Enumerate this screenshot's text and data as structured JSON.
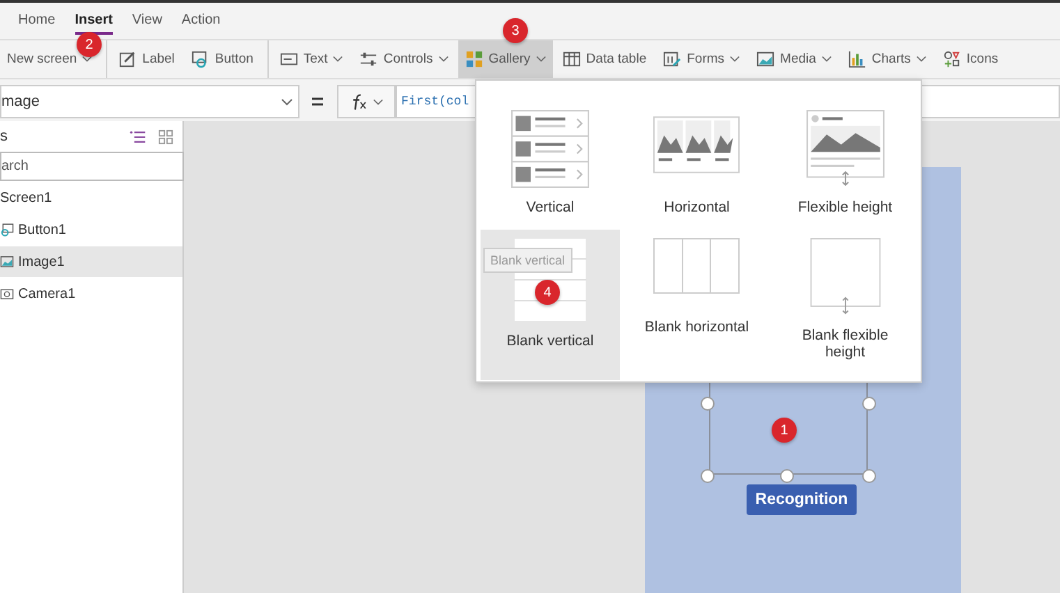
{
  "menu": [
    {
      "label": "Home",
      "selected": false
    },
    {
      "label": "Insert",
      "selected": true
    },
    {
      "label": "View",
      "selected": false
    },
    {
      "label": "Action",
      "selected": false
    }
  ],
  "toolbar": {
    "groups": [
      [
        {
          "label": "New screen",
          "dropdown": true,
          "selected": false
        }
      ],
      [
        {
          "label": "Label",
          "dropdown": false,
          "selected": false
        },
        {
          "label": "Button",
          "dropdown": false,
          "selected": false
        }
      ],
      [
        {
          "label": "Text",
          "dropdown": true,
          "selected": false
        },
        {
          "label": "Controls",
          "dropdown": true,
          "selected": false
        },
        {
          "label": "Gallery",
          "dropdown": true,
          "selected": true
        },
        {
          "label": "Data table",
          "dropdown": false,
          "selected": false
        },
        {
          "label": "Forms",
          "dropdown": true,
          "selected": false
        },
        {
          "label": "Media",
          "dropdown": true,
          "selected": false
        },
        {
          "label": "Charts",
          "dropdown": true,
          "selected": false
        },
        {
          "label": "Icons",
          "dropdown": false,
          "selected": false
        }
      ]
    ]
  },
  "formula_bar": {
    "property": "mage",
    "formula": "First(col"
  },
  "tree_view": {
    "title": "s",
    "search": {
      "placeholder": "arch"
    },
    "items": [
      {
        "label": "Screen1",
        "selected": false,
        "children": [
          {
            "label": "Button1",
            "selected": false
          },
          {
            "label": "Image1",
            "selected": true
          },
          {
            "label": "Camera1",
            "selected": false
          }
        ]
      }
    ]
  },
  "canvas": {
    "button": "Recognition"
  },
  "gallery_menu": {
    "tooltip": "Blank vertical",
    "options": [
      {
        "kind": "vertical",
        "label": "Vertical",
        "selected": false
      },
      {
        "kind": "horizontal",
        "label": "Horizontal",
        "selected": false
      },
      {
        "kind": "flexible",
        "label": "Flexible height",
        "selected": false
      },
      {
        "kind": "blank-vertical",
        "label": "Blank vertical",
        "selected": true
      },
      {
        "kind": "blank-horizontal",
        "label": "Blank horizontal",
        "selected": false
      },
      {
        "kind": "blank-flexible",
        "label": "Blank flexible height",
        "selected": false
      }
    ]
  },
  "step_badges": [
    {
      "label": "1"
    },
    {
      "label": "2"
    },
    {
      "label": "3"
    },
    {
      "label": "4"
    }
  ]
}
